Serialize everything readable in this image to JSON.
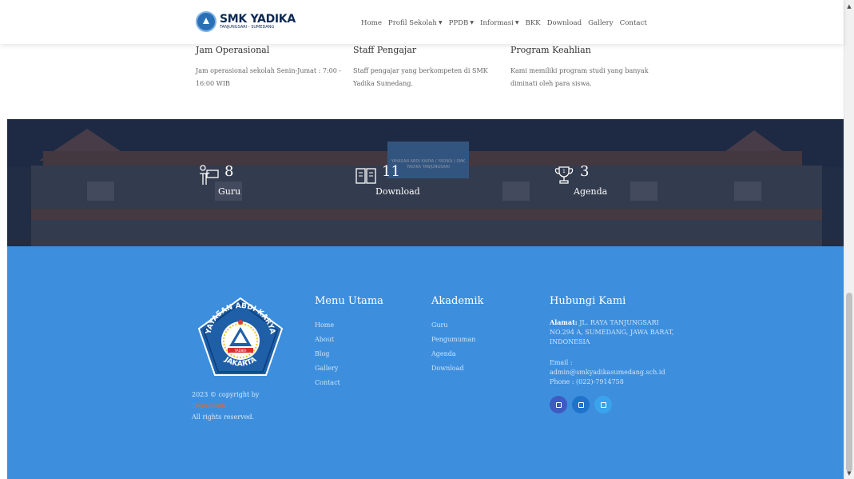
{
  "header": {
    "logo_title": "SMK YADIKA",
    "logo_subtitle": "TANJUNGSARI - SUMEDANG",
    "nav": [
      {
        "label": "Home"
      },
      {
        "label": "Profil Sekolah",
        "dropdown": true
      },
      {
        "label": "PPDB",
        "dropdown": true
      },
      {
        "label": "Informasi",
        "dropdown": true
      },
      {
        "label": "BKK"
      },
      {
        "label": "Download"
      },
      {
        "label": "Gallery"
      },
      {
        "label": "Contact"
      }
    ]
  },
  "features": [
    {
      "title": "Jam Operasional",
      "text": "Jam operasional sekolah Senin-Jumat : 7:00 - 16:00 WIB"
    },
    {
      "title": "Staff Pengajar",
      "text": "Staff pengajar yang berkompeten di SMK Yadika Sumedang."
    },
    {
      "title": "Program Keahlian",
      "text": "Kami memiliki program studi yang banyak diminati oleh para siswa."
    }
  ],
  "counters": {
    "sign_text": "YAYASAN ABDI KARYA ( YADIKA ) SMK YADIKA TANJUNGSARI",
    "items": [
      {
        "icon": "teacher-icon",
        "value": "8",
        "label": "Guru"
      },
      {
        "icon": "book-icon",
        "value": "11",
        "label": "Download"
      },
      {
        "icon": "trophy-icon",
        "value": "3",
        "label": "Agenda"
      }
    ]
  },
  "footer": {
    "emblem_text": {
      "top": "YAYASAN ABDI KARYA",
      "bottom": "JAKARTA",
      "ribbon": "YADIKA"
    },
    "copyright": {
      "line1": "2023 © copyright by",
      "author": "TeuKaisun",
      "line3": "All rights reserved."
    },
    "menu_utama": {
      "title": "Menu Utama",
      "items": [
        "Home",
        "About",
        "Blog",
        "Gallery",
        "Contact"
      ]
    },
    "akademik": {
      "title": "Akademik",
      "items": [
        "Guru",
        "Pengumuman",
        "Agenda",
        "Download"
      ]
    },
    "hubungi": {
      "title": "Hubungi Kami",
      "address_label": "Alamat:",
      "address": "JL. RAYA TANJUNGSARI NO.294 A, SUMEDANG, JAWA BARAT, INDONESIA",
      "email_label": "Email :",
      "email": "admin@smkyadikasumedang.sch.id",
      "phone": "Phone : (022)-7914758",
      "socials": [
        {
          "icon": "instagram-icon",
          "color": "#3e5bbf"
        },
        {
          "icon": "facebook-icon",
          "color": "#1f73c9"
        },
        {
          "icon": "twitter-icon",
          "color": "#3aa3ec"
        }
      ]
    }
  },
  "colors": {
    "footer_bg": "#3d8fde",
    "accent": "#e06b3a",
    "logo_navy": "#0d2a55"
  }
}
